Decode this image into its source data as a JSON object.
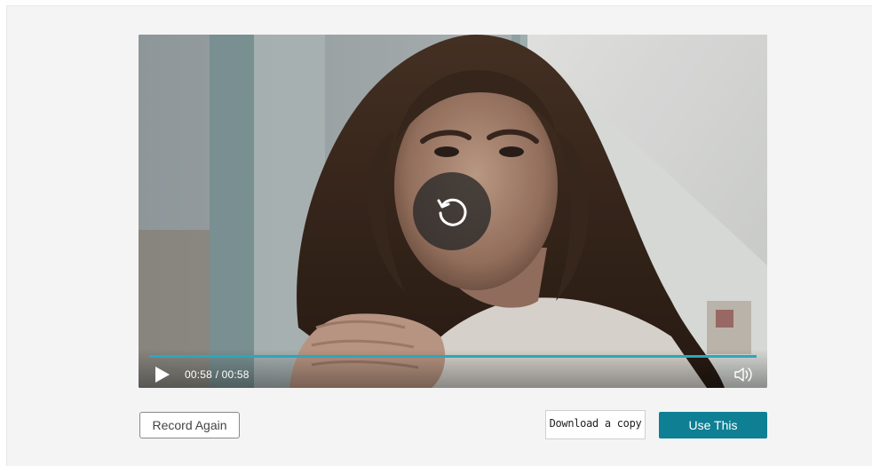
{
  "player": {
    "time_display": "00:58 / 00:58",
    "progress_fraction": 1.0,
    "accent_color": "#2aa7bd",
    "replay_icon": "replay-icon",
    "play_icon": "play-icon",
    "volume_icon": "volume-icon"
  },
  "actions": {
    "record_again_label": "Record Again",
    "download_label": "Download a copy",
    "use_this_label": "Use This",
    "use_this_color": "#0f7f94"
  }
}
